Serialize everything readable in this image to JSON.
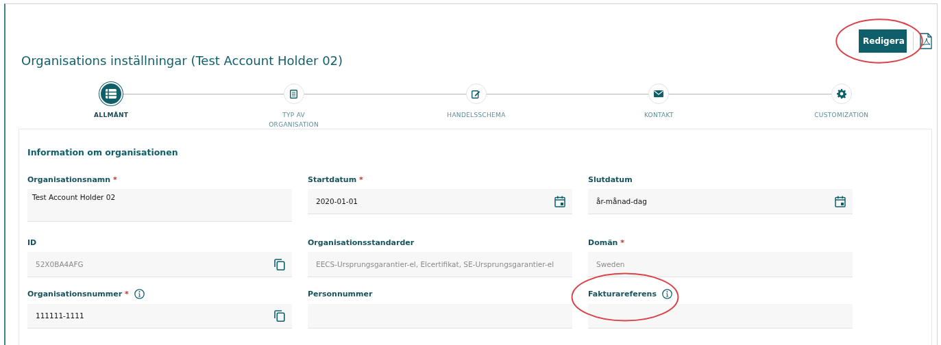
{
  "title": "Organisations inställningar (Test Account Holder 02)",
  "edit_button": {
    "label": "Redigera",
    "circled": true
  },
  "steps": [
    {
      "label": "ALLMÄNT",
      "selected": true
    },
    {
      "label": "TYP AV ORGANISATION",
      "selected": false
    },
    {
      "label": "HANDELSSCHEMA",
      "selected": false
    },
    {
      "label": "KONTAKT",
      "selected": false
    },
    {
      "label": "CUSTOMIZATION",
      "selected": false
    }
  ],
  "section": {
    "heading": "Information om organisationen",
    "fields": [
      {
        "label": "Organisationsnamn",
        "required_mark": "*",
        "info": false,
        "kind": "textarea",
        "value": "Test Account Holder 02",
        "muted": false,
        "circled": false
      },
      {
        "label": "Startdatum",
        "required_mark": "*",
        "info": false,
        "kind": "date",
        "value": "2020-01-01",
        "muted": false,
        "circled": false
      },
      {
        "label": "Slutdatum",
        "info": false,
        "kind": "date",
        "value": "år-månad-dag",
        "muted": false,
        "circled": false
      },
      {
        "label": "ID",
        "info": false,
        "kind": "copy",
        "value": "52X0BA4AFG",
        "muted": true,
        "circled": false
      },
      {
        "label": "Organisationsstandarder",
        "info": false,
        "kind": "text",
        "value": "EECS-Ursprungsgarantier-el, Elcertifikat, SE-Ursprungsgarantier-el",
        "muted": true,
        "circled": false
      },
      {
        "label": "Domän",
        "required_mark": "*",
        "info": false,
        "kind": "text",
        "value": "Sweden",
        "muted": true,
        "circled": false
      },
      {
        "label": "Organisationsnummer",
        "required_mark": "*",
        "info": true,
        "kind": "copy",
        "value": "111111-1111",
        "muted": false,
        "circled": false
      },
      {
        "label": "Personnummer",
        "info": false,
        "kind": "text",
        "circled": false
      },
      {
        "label": "Fakturareferens",
        "info": true,
        "kind": "text",
        "circled": true
      }
    ]
  }
}
